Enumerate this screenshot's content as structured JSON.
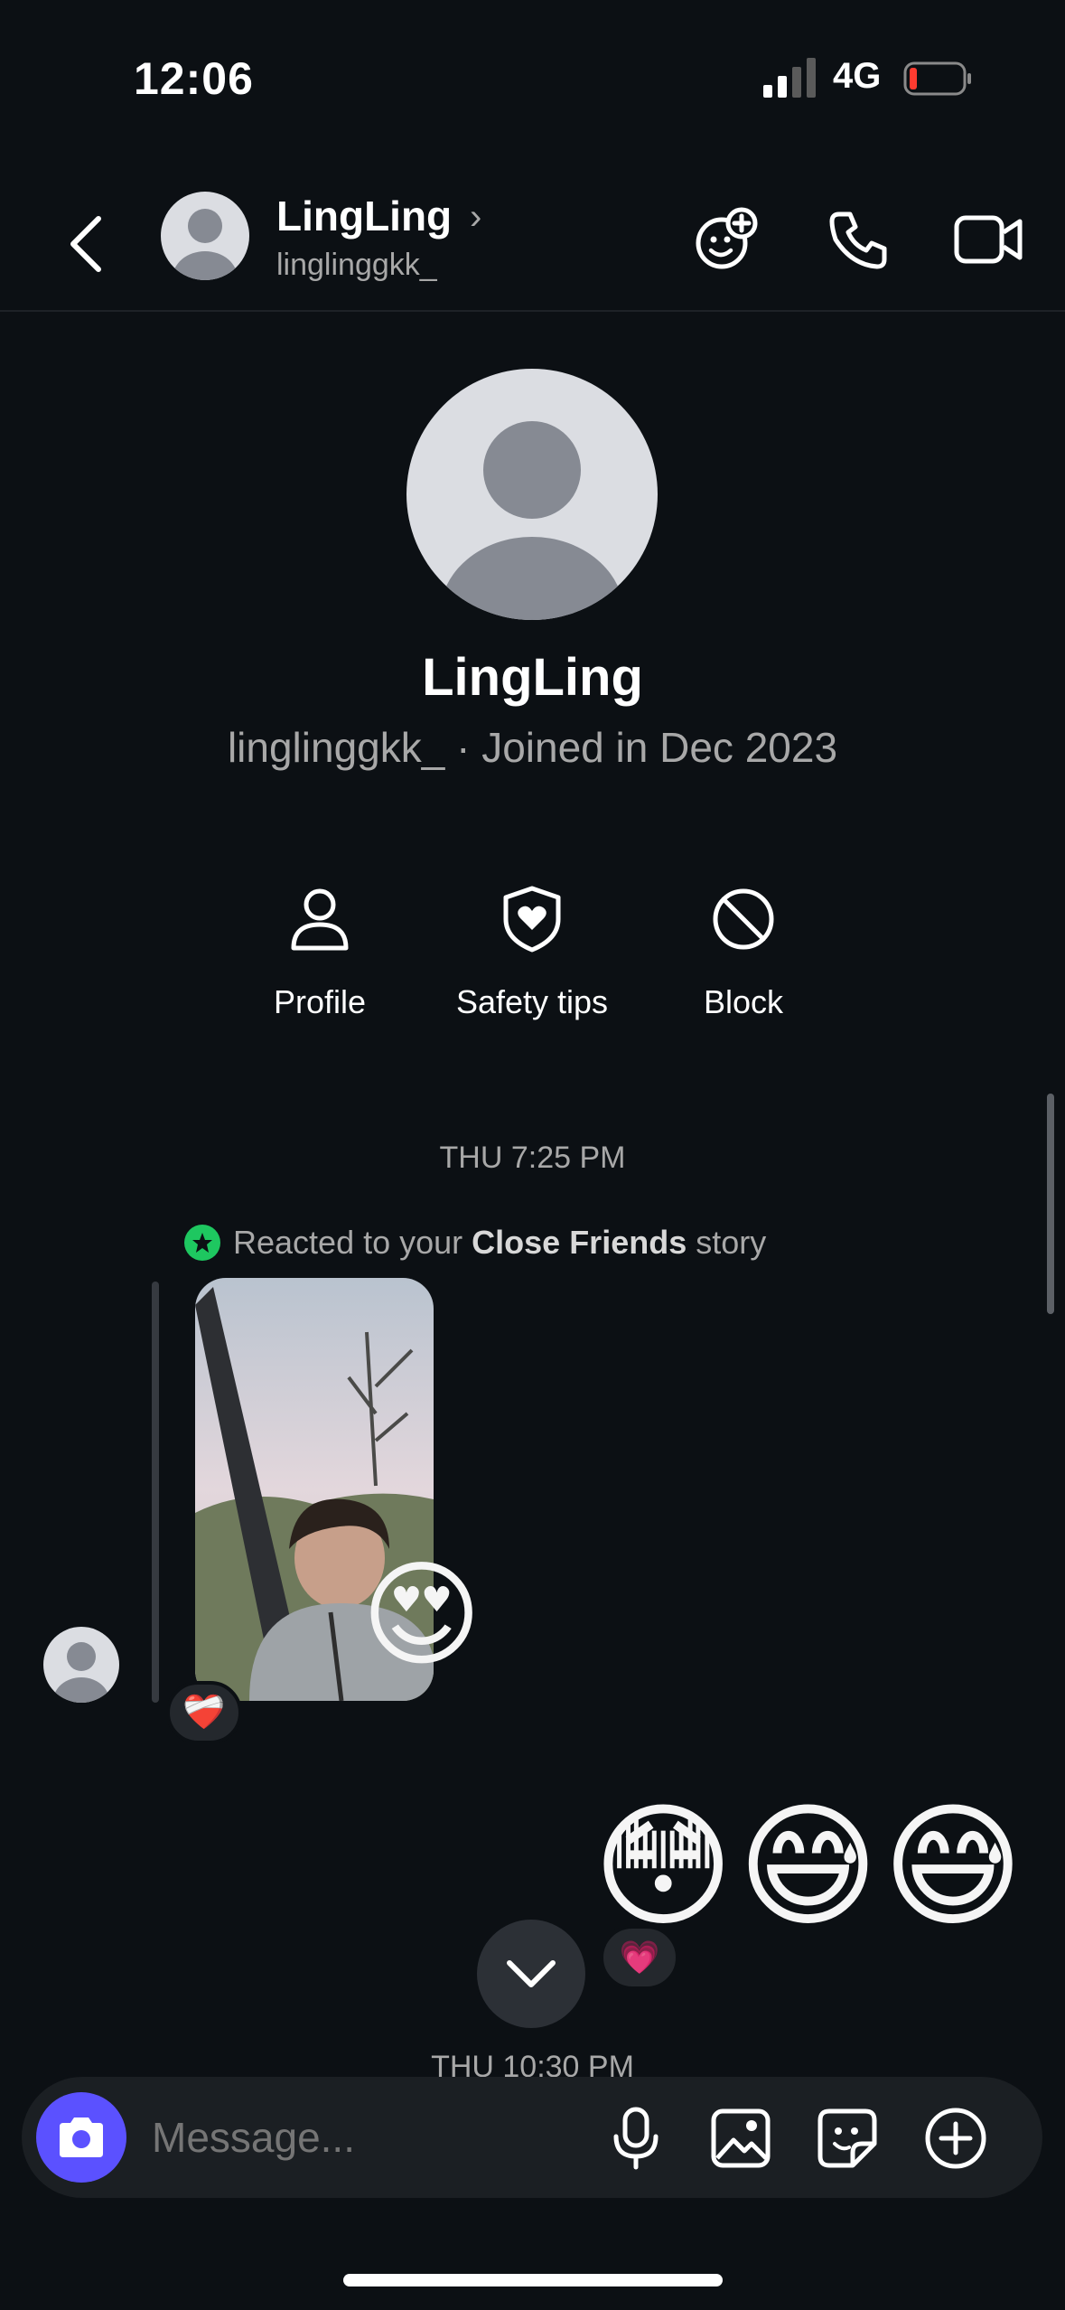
{
  "status_bar": {
    "time": "12:06",
    "network": "4G",
    "signal_bars": 2,
    "battery_level": 0.1
  },
  "header": {
    "name": "LingLing",
    "username": "linglinggkk_",
    "chevron": "›",
    "icons": [
      "back-arrow-icon",
      "add-effects-icon",
      "phone-icon",
      "video-icon"
    ]
  },
  "profile": {
    "name": "LingLing",
    "subtitle": "linglinggkk_ · Joined in Dec 2023",
    "actions": [
      {
        "label": "Profile",
        "icon": "person-icon"
      },
      {
        "label": "Safety tips",
        "icon": "shield-heart-icon"
      },
      {
        "label": "Block",
        "icon": "block-icon"
      }
    ]
  },
  "chat": {
    "timestamp1": "THU 7:25 PM",
    "reacted_prefix": "Reacted to your",
    "reacted_bold": "Close Friends",
    "reacted_suffix": "story",
    "story_reaction_emoji": "😍",
    "story_reaction_badge": "❤️‍🩹",
    "sent_emojis": "😳😅😅",
    "sent_reaction_badge": "💗",
    "timestamp2": "THU 10:30 PM"
  },
  "composer": {
    "placeholder": "Message..."
  },
  "colors": {
    "background": "#0c1014",
    "accent": "#5b51ff",
    "close_friends": "#1ec760"
  }
}
